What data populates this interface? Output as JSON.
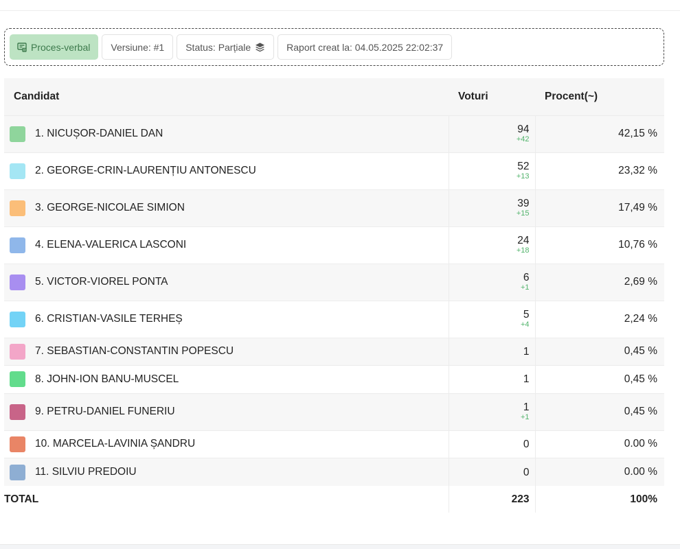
{
  "toolbar": {
    "proces_verbal": "Proces-verbal",
    "version": "Versiune: #1",
    "status": "Status: Parțiale",
    "report_created": "Raport creat la: 04.05.2025 22:02:37",
    "icons": {
      "proces_verbal": "document-stamp-icon",
      "status": "layers-icon"
    },
    "primary_color": "#bde3c3"
  },
  "table": {
    "headers": {
      "candidate": "Candidat",
      "votes": "Voturi",
      "percent": "Procent(~)"
    },
    "rows": [
      {
        "name": "1. NICUȘOR-DANIEL DAN",
        "votes": "94",
        "delta": "+42",
        "percent": "42,15 %",
        "color": "#8fd59c"
      },
      {
        "name": "2. GEORGE-CRIN-LAURENȚIU ANTONESCU",
        "votes": "52",
        "delta": "+13",
        "percent": "23,32 %",
        "color": "#a4e6f4"
      },
      {
        "name": "3. GEORGE-NICOLAE SIMION",
        "votes": "39",
        "delta": "+15",
        "percent": "17,49 %",
        "color": "#fbbe79"
      },
      {
        "name": "4. ELENA-VALERICA LASCONI",
        "votes": "24",
        "delta": "+18",
        "percent": "10,76 %",
        "color": "#8fb7ea"
      },
      {
        "name": "5. VICTOR-VIOREL PONTA",
        "votes": "6",
        "delta": "+1",
        "percent": "2,69 %",
        "color": "#a88ef0"
      },
      {
        "name": "6. CRISTIAN-VASILE TERHEȘ",
        "votes": "5",
        "delta": "+4",
        "percent": "2,24 %",
        "color": "#73d3f6"
      },
      {
        "name": "7. SEBASTIAN-CONSTANTIN POPESCU",
        "votes": "1",
        "delta": "",
        "percent": "0,45 %",
        "color": "#f3a6c8"
      },
      {
        "name": "8. JOHN-ION BANU-MUSCEL",
        "votes": "1",
        "delta": "",
        "percent": "0,45 %",
        "color": "#62dc8c"
      },
      {
        "name": "9. PETRU-DANIEL FUNERIU",
        "votes": "1",
        "delta": "+1",
        "percent": "0,45 %",
        "color": "#c86488"
      },
      {
        "name": "10. MARCELA-LAVINIA ȘANDRU",
        "votes": "0",
        "delta": "",
        "percent": "0.00 %",
        "color": "#e98566"
      },
      {
        "name": "11. SILVIU PREDOIU",
        "votes": "0",
        "delta": "",
        "percent": "0.00 %",
        "color": "#8eaed3"
      }
    ],
    "total": {
      "label": "TOTAL",
      "votes": "223",
      "percent": "100%"
    }
  }
}
